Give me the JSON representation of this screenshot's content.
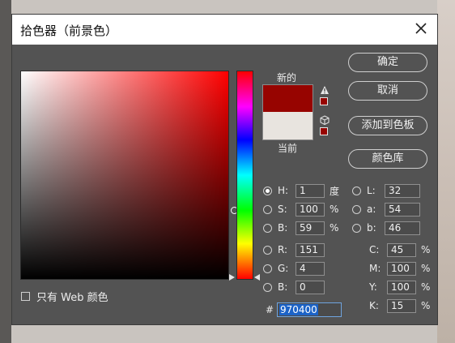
{
  "dialog": {
    "title": "拾色器（前景色）"
  },
  "buttons": {
    "ok": "确定",
    "cancel": "取消",
    "add_to_swatches": "添加到色板",
    "color_libraries": "颜色库"
  },
  "preview": {
    "new_label": "新的",
    "current_label": "当前",
    "new_color": "#970400",
    "current_color": "#e8e4df"
  },
  "websafe": {
    "label": "只有 Web 颜色",
    "checked": false
  },
  "hsb": {
    "h": {
      "label": "H:",
      "value": "1",
      "unit": "度",
      "selected": true
    },
    "s": {
      "label": "S:",
      "value": "100",
      "unit": "%",
      "selected": false
    },
    "b": {
      "label": "B:",
      "value": "59",
      "unit": "%",
      "selected": false
    }
  },
  "lab": {
    "l": {
      "label": "L:",
      "value": "32",
      "selected": false
    },
    "a": {
      "label": "a:",
      "value": "54",
      "selected": false
    },
    "b": {
      "label": "b:",
      "value": "46",
      "selected": false
    }
  },
  "rgb": {
    "r": {
      "label": "R:",
      "value": "151",
      "selected": false
    },
    "g": {
      "label": "G:",
      "value": "4",
      "selected": false
    },
    "b": {
      "label": "B:",
      "value": "0",
      "selected": false
    }
  },
  "cmyk": {
    "c": {
      "label": "C:",
      "value": "45",
      "unit": "%"
    },
    "m": {
      "label": "M:",
      "value": "100",
      "unit": "%"
    },
    "y": {
      "label": "Y:",
      "value": "100",
      "unit": "%"
    },
    "k": {
      "label": "K:",
      "value": "15",
      "unit": "%"
    }
  },
  "hex": {
    "label": "#",
    "value": "970400"
  },
  "icons": {
    "close": "close-icon",
    "gamut_warning": "warning-triangle-icon",
    "web_safe": "cube-icon"
  }
}
